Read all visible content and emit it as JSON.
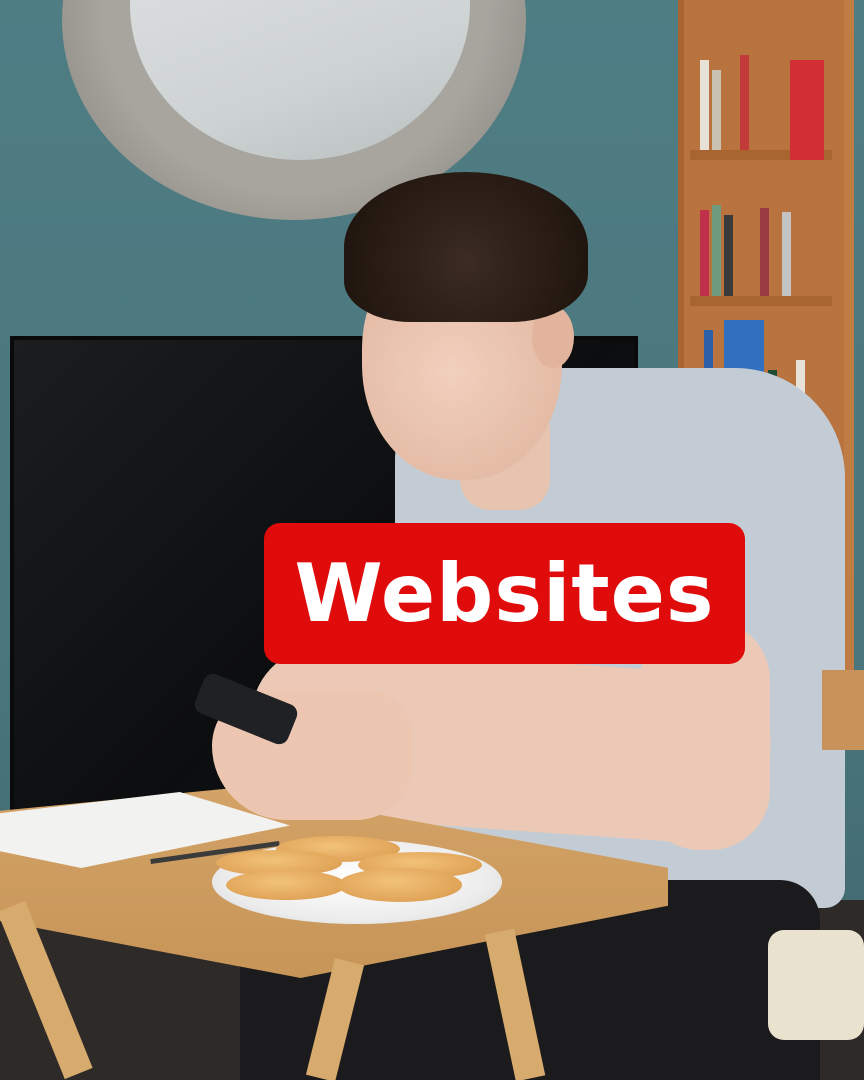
{
  "caption": {
    "text": "Websites",
    "background": "#e00b0b",
    "color": "#ffffff"
  },
  "scene": {
    "elements": [
      "round-mirror",
      "bookshelf",
      "television",
      "person-with-phone",
      "folding-table",
      "plate-of-cookies",
      "paper-sheet",
      "chair"
    ]
  }
}
